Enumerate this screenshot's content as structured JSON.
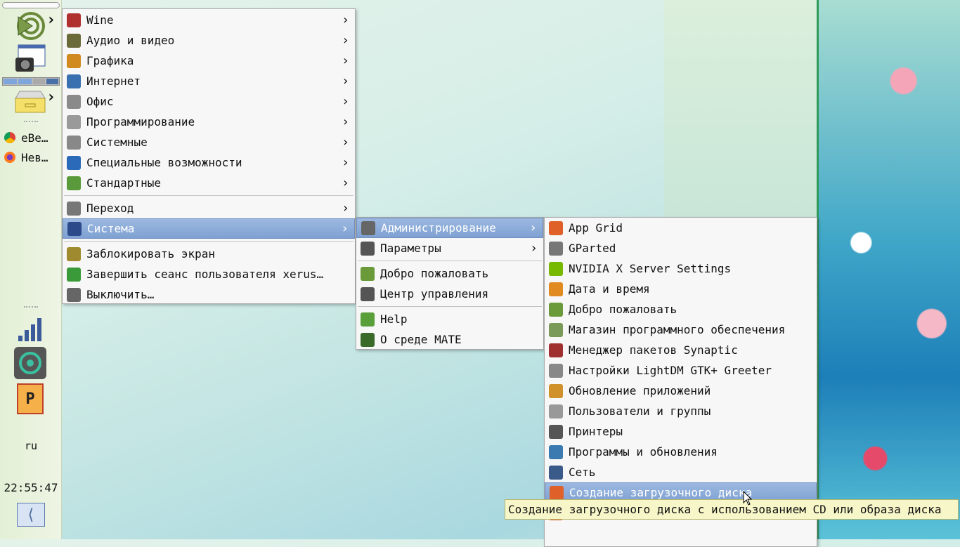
{
  "panel": {
    "tasks": [
      "eBe…",
      "Нев…"
    ],
    "keyboard_layout": "ru",
    "clock": "22:55:47"
  },
  "menu_main": {
    "items": [
      {
        "label": "Wine",
        "icon": "wine-icon",
        "color": "#b03030",
        "submenu": true
      },
      {
        "label": "Аудио и видео",
        "icon": "multimedia-icon",
        "color": "#6a6a3a",
        "submenu": true
      },
      {
        "label": "Графика",
        "icon": "graphics-icon",
        "color": "#d08a20",
        "submenu": true
      },
      {
        "label": "Интернет",
        "icon": "internet-icon",
        "color": "#3a70b0",
        "submenu": true
      },
      {
        "label": "Офис",
        "icon": "office-icon",
        "color": "#8a8a8a",
        "submenu": true
      },
      {
        "label": "Программирование",
        "icon": "programming-icon",
        "color": "#9a9a9a",
        "submenu": true
      },
      {
        "label": "Системные",
        "icon": "system-tools-icon",
        "color": "#888",
        "submenu": true
      },
      {
        "label": "Специальные возможности",
        "icon": "accessibility-icon",
        "color": "#2a6ab8",
        "submenu": true
      },
      {
        "label": "Стандартные",
        "icon": "accessories-icon",
        "color": "#5a9a3a",
        "submenu": true
      }
    ],
    "places": {
      "label": "Переход",
      "icon": "folder-icon",
      "color": "#777"
    },
    "system": {
      "label": "Система",
      "icon": "computer-icon",
      "color": "#2a4a8a"
    },
    "actions": [
      {
        "label": "Заблокировать экран",
        "icon": "lock-screen-icon",
        "color": "#a08a30"
      },
      {
        "label": "Завершить сеанс пользователя xerus…",
        "icon": "logout-icon",
        "color": "#3a9a3a"
      },
      {
        "label": "Выключить…",
        "icon": "shutdown-icon",
        "color": "#666"
      }
    ]
  },
  "menu_system": {
    "items": [
      {
        "label": "Администрирование",
        "icon": "administration-icon",
        "color": "#666",
        "submenu": true
      },
      {
        "label": "Параметры",
        "icon": "preferences-icon",
        "color": "#555",
        "submenu": true
      },
      {
        "label": "Добро пожаловать",
        "icon": "welcome-icon",
        "color": "#6a9a3a"
      },
      {
        "label": "Центр управления",
        "icon": "control-center-icon",
        "color": "#555"
      },
      {
        "label": "Help",
        "icon": "help-icon",
        "color": "#5aa03a"
      },
      {
        "label": "О среде MATE",
        "icon": "mate-icon",
        "color": "#3a6a2a"
      }
    ]
  },
  "menu_admin": {
    "items": [
      {
        "label": "App Grid",
        "icon": "app-grid-icon",
        "color": "#e0602a"
      },
      {
        "label": "GParted",
        "icon": "gparted-icon",
        "color": "#777"
      },
      {
        "label": "NVIDIA X Server Settings",
        "icon": "nvidia-icon",
        "color": "#76b900"
      },
      {
        "label": "Дата и время",
        "icon": "date-time-icon",
        "color": "#e08a20"
      },
      {
        "label": "Добро пожаловать",
        "icon": "welcome-icon",
        "color": "#6a9a3a"
      },
      {
        "label": "Магазин программного обеспечения",
        "icon": "software-store-icon",
        "color": "#7a9a5a"
      },
      {
        "label": "Менеджер пакетов Synaptic",
        "icon": "synaptic-icon",
        "color": "#a03030"
      },
      {
        "label": "Настройки LightDM GTK+ Greeter",
        "icon": "lightdm-icon",
        "color": "#888"
      },
      {
        "label": "Обновление приложений",
        "icon": "update-icon",
        "color": "#d0902a"
      },
      {
        "label": "Пользователи и группы",
        "icon": "users-icon",
        "color": "#999"
      },
      {
        "label": "Принтеры",
        "icon": "printer-icon",
        "color": "#555"
      },
      {
        "label": "Программы и обновления",
        "icon": "software-sources-icon",
        "color": "#3a7ab0"
      },
      {
        "label": "Сеть",
        "icon": "network-icon",
        "color": "#3a5a8a"
      },
      {
        "label": "Создание загрузочного диска",
        "icon": "startup-disk-icon",
        "color": "#e0602a"
      }
    ]
  },
  "tooltip": "Создание загрузочного диска с использованием CD или образа диска"
}
